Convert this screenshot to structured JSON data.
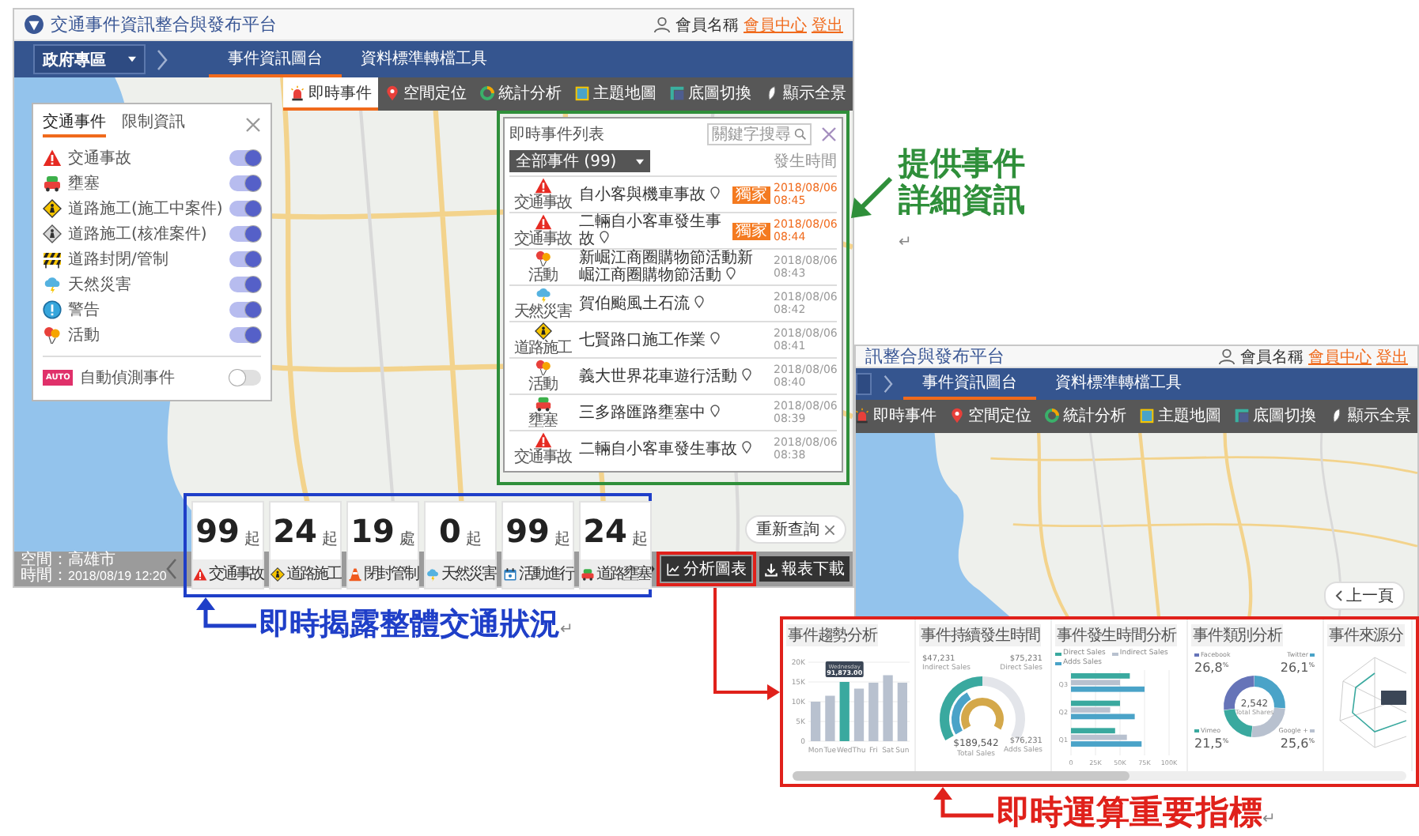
{
  "main_window": {
    "title": "交通事件資訊整合與發布平台",
    "user": {
      "name": "會員名稱",
      "links": [
        "會員中心",
        "登出"
      ]
    },
    "zone": "政府專區",
    "nav_tabs": [
      {
        "label": "事件資訊圖台",
        "selected": true
      },
      {
        "label": "資料標準轉檔工具",
        "selected": false
      }
    ],
    "toolbar": [
      {
        "kind": "siren",
        "label": "即時事件",
        "selected": true
      },
      {
        "kind": "pin",
        "label": "空間定位",
        "selected": false
      },
      {
        "kind": "ring",
        "label": "統計分析",
        "selected": false
      },
      {
        "kind": "book",
        "label": "主題地圖",
        "selected": false
      },
      {
        "kind": "corner",
        "label": "底圖切換",
        "selected": false
      },
      {
        "kind": "leaf",
        "label": "顯示全景",
        "selected": false
      }
    ],
    "legend": {
      "tabs": [
        {
          "label": "交通事件",
          "selected": true
        },
        {
          "label": "限制資訊",
          "selected": false
        }
      ],
      "items": [
        {
          "kind": "accident",
          "label": "交通事故",
          "on": true
        },
        {
          "kind": "congestion",
          "label": "壅塞",
          "on": true
        },
        {
          "kind": "construction",
          "label": "道路施工(施工中案件)",
          "on": true
        },
        {
          "kind": "approved",
          "label": "道路施工(核准案件)",
          "on": true
        },
        {
          "kind": "closure",
          "label": "道路封閉/管制",
          "on": true
        },
        {
          "kind": "disaster",
          "label": "天然災害",
          "on": true
        },
        {
          "kind": "warning",
          "label": "警告",
          "on": true
        },
        {
          "kind": "event",
          "label": "活動",
          "on": true
        }
      ],
      "auto": {
        "badge": "AUTO",
        "label": "自動偵測事件",
        "on": false
      }
    },
    "event_list": {
      "title": "即時事件列表",
      "search": {
        "placeholder": "關鍵字搜尋"
      },
      "filter": "全部事件 (99)",
      "time_header": "發生時間",
      "rows": [
        {
          "kind": "accident",
          "category": "交通事故",
          "title": "自小客與機車事故",
          "badge": "獨家",
          "date": "2018/08/06",
          "time": "08:45",
          "highlighted": true
        },
        {
          "kind": "accident",
          "category": "交通事故",
          "title": "二輛自小客車發生事故",
          "badge": "獨家",
          "date": "2018/08/06",
          "time": "08:44",
          "highlighted": true
        },
        {
          "kind": "event",
          "category": "活動",
          "title": "新崛江商圈購物節活動新崛江商圈購物節活動",
          "date": "2018/08/06",
          "time": "08:43",
          "highlighted": false
        },
        {
          "kind": "disaster",
          "category": "天然災害",
          "title": "賀伯颱風土石流",
          "date": "2018/08/06",
          "time": "08:42",
          "highlighted": false
        },
        {
          "kind": "construction",
          "category": "道路施工",
          "title": "七賢路口施工作業",
          "date": "2018/08/06",
          "time": "08:41",
          "highlighted": false
        },
        {
          "kind": "event",
          "category": "活動",
          "title": "義大世界花車遊行活動",
          "date": "2018/08/06",
          "time": "08:40",
          "highlighted": false
        },
        {
          "kind": "congestion",
          "category": "壅塞",
          "title": "三多路匯路壅塞中",
          "date": "2018/08/06",
          "time": "08:39",
          "highlighted": false
        },
        {
          "kind": "accident",
          "category": "交通事故",
          "title": "二輛自小客車發生事故",
          "date": "2018/08/06",
          "time": "08:38",
          "highlighted": false
        }
      ]
    },
    "requery": "重新查詢",
    "status": [
      {
        "kind": "place",
        "label": "空間：",
        "value": "高雄市"
      },
      {
        "kind": "time",
        "label": "時間：",
        "value": "2018/08/19 12:20"
      }
    ],
    "stats": [
      {
        "kind": "accident",
        "count": "99",
        "unit": "起",
        "label": "交通事故"
      },
      {
        "kind": "construction",
        "count": "24",
        "unit": "起",
        "label": "道路施工"
      },
      {
        "kind": "cone",
        "count": "19",
        "unit": "處",
        "label": "閉封管制"
      },
      {
        "kind": "disaster",
        "count": "0",
        "unit": "起",
        "label": "天然災害"
      },
      {
        "kind": "calendar",
        "count": "99",
        "unit": "起",
        "label": "活動進行"
      },
      {
        "kind": "congestion",
        "count": "24",
        "unit": "起",
        "label": "道路壅塞"
      }
    ],
    "buttons": [
      {
        "kind": "chart",
        "label": "分析圖表"
      },
      {
        "kind": "download",
        "label": "報表下載"
      }
    ]
  },
  "second_window": {
    "title": "訊整合與發布平台",
    "user": {
      "name": "會員名稱",
      "links": [
        "會員中心",
        "登出"
      ]
    },
    "nav_tabs": [
      {
        "label": "事件資訊圖台",
        "selected": true
      },
      {
        "label": "資料標準轉檔工具",
        "selected": false
      }
    ],
    "toolbar": [
      {
        "kind": "siren",
        "label": "即時事件",
        "selected": false
      },
      {
        "kind": "pin",
        "label": "空間定位",
        "selected": false
      },
      {
        "kind": "ring",
        "label": "統計分析",
        "selected": false
      },
      {
        "kind": "book",
        "label": "主題地圖",
        "selected": false
      },
      {
        "kind": "corner",
        "label": "底圖切換",
        "selected": false
      },
      {
        "kind": "leaf",
        "label": "顯示全景",
        "selected": false
      }
    ],
    "back_button": "上一頁"
  },
  "analytics": [
    {
      "title": "事件趨勢分析",
      "tooltip": {
        "label": "Wednesday",
        "value": "91,873.00"
      },
      "bar_selected": [
        false,
        false,
        true,
        false,
        false,
        false,
        false
      ],
      "chart_data": {
        "type": "bar",
        "categories": [
          "Mon",
          "Tue",
          "Wed",
          "Thu",
          "Fri",
          "Sat",
          "Sun"
        ],
        "values": [
          10000,
          11500,
          15000,
          13300,
          14800,
          16700,
          14800
        ],
        "yticks": [
          0,
          {
            "value": 5000,
            "label": "5K"
          },
          {
            "value": 10000,
            "label": "10K"
          },
          {
            "value": 15000,
            "label": "15K"
          },
          {
            "value": 20000,
            "label": "20K"
          }
        ],
        "ylim": [
          0,
          20000
        ],
        "grid": true
      }
    },
    {
      "kind": "gauge",
      "title": "事件持續發生時間",
      "total": {
        "value": "$189,542",
        "label": "Total Sales"
      },
      "parts": [
        {
          "value": "$47,231",
          "label": "Indirect Sales"
        },
        {
          "value": "$75,231",
          "label": "Direct Sales"
        },
        {
          "value": "$76,231",
          "label": "Adds Sales"
        }
      ]
    },
    {
      "title": "事件發生時間分析",
      "chart_data": {
        "type": "bar",
        "orientation": "horizontal",
        "categories": [
          "Q3",
          "Q2",
          "Q1"
        ],
        "series": [
          {
            "name": "Direct Sales",
            "color": "#3aa99f",
            "values": [
              60000,
              50000,
              45000
            ]
          },
          {
            "name": "Indirect Sales",
            "color": "#b8c1cf",
            "values": [
              50000,
              40000,
              57000
            ]
          },
          {
            "name": "Adds Sales",
            "color": "#4aa3c8",
            "values": [
              75000,
              65000,
              72000
            ]
          }
        ],
        "xticks": [
          0,
          {
            "value": 25000,
            "label": "25K"
          },
          {
            "value": 50000,
            "label": "50K"
          },
          {
            "value": 75000,
            "label": "75K"
          },
          {
            "value": 100000,
            "label": "100K"
          }
        ],
        "xlim": [
          0,
          100000
        ],
        "grid": true,
        "legend": "top"
      }
    },
    {
      "title": "事件類別分析",
      "total": "2,542",
      "total_label": "Total Shares",
      "labels": [
        {
          "value": "26,8",
          "unit": "%",
          "color": "#6674b8"
        },
        {
          "value": "26,1",
          "unit": "%",
          "color": "#4aa3c8"
        },
        {
          "value": "21,5",
          "unit": "%",
          "color": "#3aa99f"
        },
        {
          "value": "25,6",
          "unit": "%",
          "color": "#b8c1cf"
        }
      ],
      "chart_data": {
        "type": "donut",
        "categories": [
          "Facebook",
          "Twitter",
          "Vimeo",
          "Google +"
        ],
        "values": [
          26.8,
          26.1,
          21.5,
          25.6
        ],
        "legend": "top right"
      }
    },
    {
      "kind": "radar",
      "title": "事件來源分"
    }
  ],
  "callouts": [
    {
      "text": "提供事件詳細資訊",
      "mark": "↵",
      "color": "#2f8f3a"
    },
    {
      "text": "即時揭露整體交通狀況",
      "mark": "↵",
      "color": "#1f3fc8"
    },
    {
      "text": "即時運算重要指標",
      "mark": "↵",
      "color": "#e0211b"
    }
  ]
}
